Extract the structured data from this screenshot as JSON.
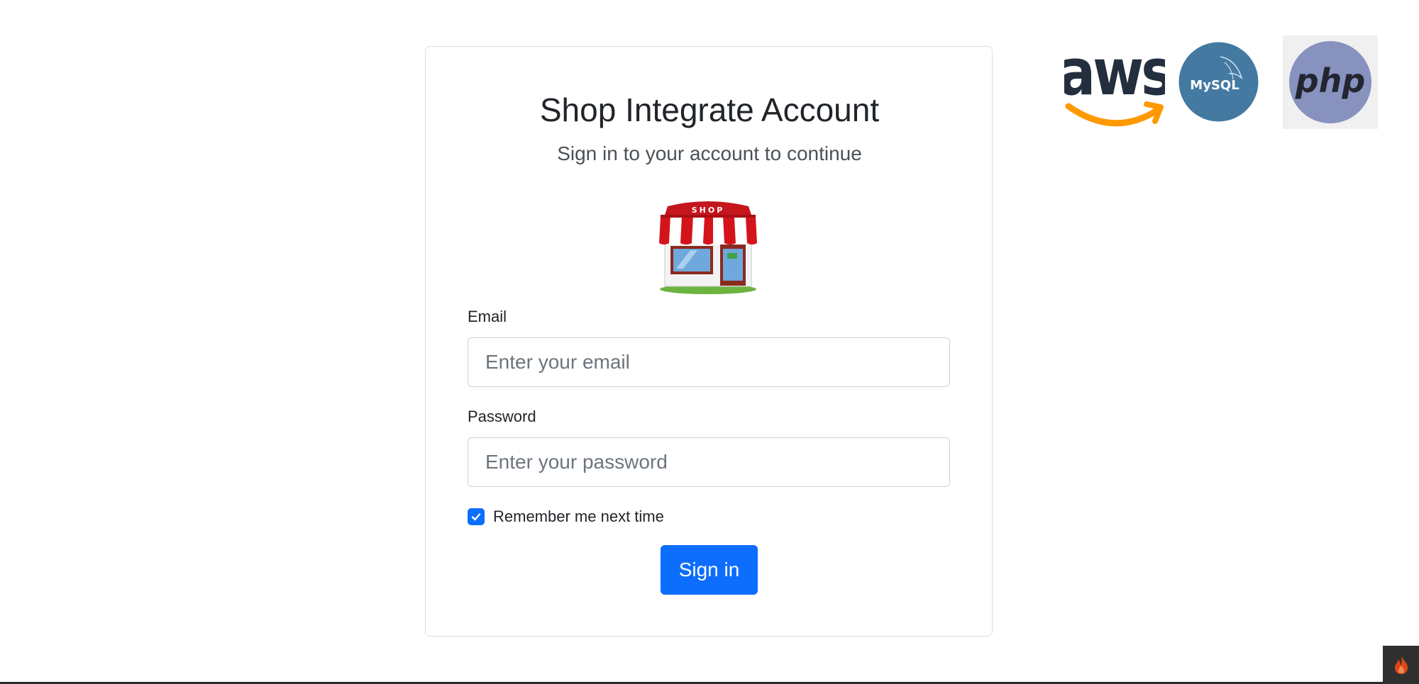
{
  "login": {
    "title": "Shop Integrate Account",
    "subtitle": "Sign in to your account to continue",
    "shop_image_icon": "shop-storefront-icon",
    "email_label": "Email",
    "email_placeholder": "Enter your email",
    "email_value": "",
    "password_label": "Password",
    "password_placeholder": "Enter your password",
    "password_value": "",
    "remember_label": "Remember me next time",
    "remember_checked": true,
    "signin_label": "Sign in"
  },
  "shop_sign_text": "SHOP",
  "logos": {
    "aws_text": "aws",
    "mysql_text": "MySQL",
    "php_text": "php"
  },
  "colors": {
    "primary": "#0d6efd",
    "aws_orange": "#f90",
    "mysql_blue": "#4479a1",
    "php_purple": "#8892bf"
  },
  "footer": {
    "badge_icon": "flame-icon"
  }
}
